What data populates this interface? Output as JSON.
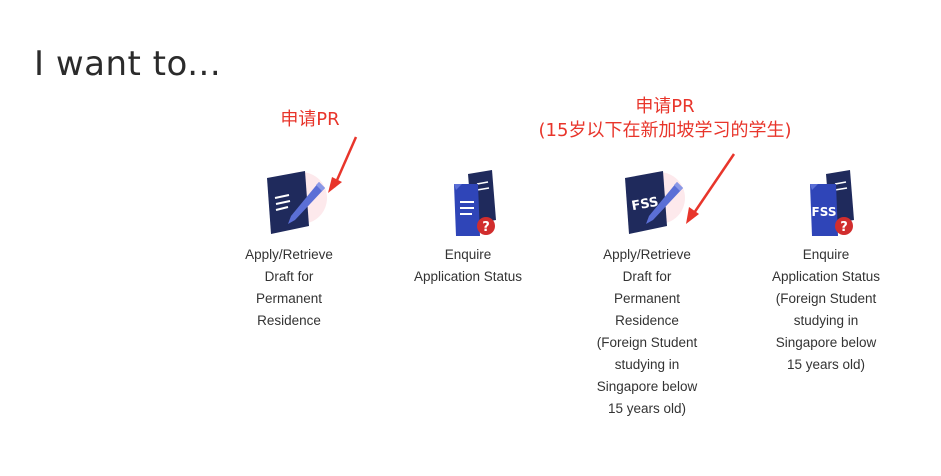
{
  "heading": "I want to...",
  "annotations": {
    "left": [
      "申请PR"
    ],
    "right": [
      "申请PR",
      "(15岁以下在新加坡学习的学生)"
    ]
  },
  "colors": {
    "navy": "#1f2a5c",
    "navy_back": "#2b3870",
    "blue_doc": "#2f45b8",
    "pen": "#5b6fd6",
    "alert_red": "#d12d2d",
    "annotation_red": "#e8352b",
    "highlight_pink": "#fde9ec"
  },
  "tiles": [
    {
      "icon": "apply-pr-document-pen-icon",
      "label_lines": [
        "Apply/Retrieve",
        "Draft for",
        "Permanent",
        "Residence"
      ]
    },
    {
      "icon": "enquire-status-documents-question-icon",
      "label_lines": [
        "Enquire",
        "Application Status"
      ]
    },
    {
      "icon": "fss-apply-document-pen-icon",
      "badge": "FSS",
      "label_lines": [
        "Apply/Retrieve",
        "Draft for",
        "Permanent",
        "Residence",
        "(Foreign Student",
        "studying in",
        "Singapore below",
        "15 years old)"
      ]
    },
    {
      "icon": "fss-enquire-documents-question-icon",
      "badge": "FSS",
      "alert_glyph": "?",
      "label_lines": [
        "Enquire",
        "Application Status",
        "(Foreign Student",
        "studying in",
        "Singapore below",
        "15 years old)"
      ]
    }
  ]
}
